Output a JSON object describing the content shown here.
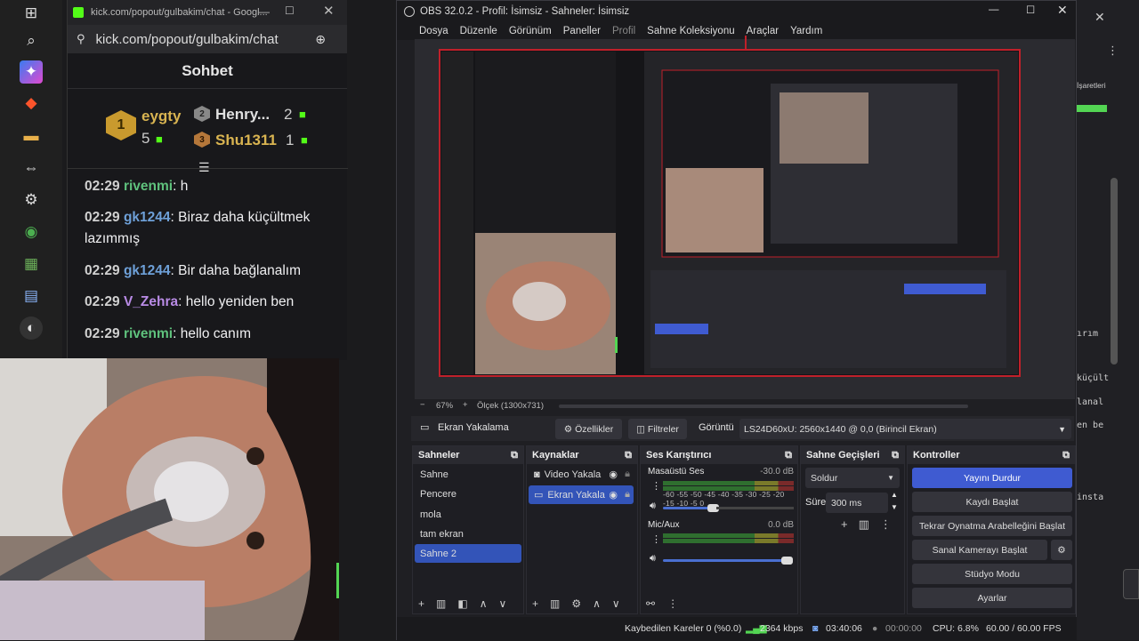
{
  "taskbar": {
    "icons": [
      "windows-icon",
      "search-icon",
      "copilot-icon",
      "brave-icon",
      "folder-icon",
      "remote-desktop-icon",
      "settings-icon",
      "chrome-icon",
      "game-icon",
      "server-icon",
      "obs-icon"
    ]
  },
  "chat": {
    "tab_title": "kick.com/popout/gulbakim/chat - Googl...",
    "url": "kick.com/popout/gulbakim/chat",
    "header": "Sohbet",
    "leaderboard": [
      {
        "rank": "1",
        "name": "eygty",
        "count": "5"
      },
      {
        "rank": "2",
        "name": "Henry...",
        "count": "2"
      },
      {
        "rank": "3",
        "name": "Shu1311",
        "count": "1"
      }
    ],
    "messages": [
      {
        "time": "02:29",
        "user": "rivenmi",
        "text": ": h",
        "color": "#5fc27d"
      },
      {
        "time": "02:29",
        "user": "gk1244",
        "text": ": Biraz daha küçültmek lazımmış",
        "color": "#6ea0d8"
      },
      {
        "time": "02:29",
        "user": "gk1244",
        "text": ": Bir daha bağlanalım",
        "color": "#6ea0d8"
      },
      {
        "time": "02:29",
        "user": "V_Zehra",
        "text": ": hello yeniden ben",
        "color": "#b98be6"
      },
      {
        "time": "02:29",
        "user": "rivenmi",
        "text": ": hello canım",
        "color": "#5fc27d"
      }
    ]
  },
  "obs": {
    "title": "OBS 32.0.2 - Profil: İsimsiz - Sahneler: İsimsiz",
    "menu": [
      "Dosya",
      "Düzenle",
      "Görünüm",
      "Paneller",
      "Profil",
      "Sahne Koleksiyonu",
      "Araçlar",
      "Yardım"
    ],
    "zoom": "67%",
    "scale": "Ölçek (1300x731)",
    "source_bar": {
      "source": "Ekran Yakalama",
      "properties": "Özellikler",
      "filters": "Filtreler",
      "display_label": "Görüntü",
      "display_value": "LS24D60xU: 2560x1440 @ 0,0 (Birincil Ekran)"
    },
    "scenes": {
      "title": "Sahneler",
      "items": [
        "Sahne",
        "Pencere",
        "mola",
        "tam ekran",
        "Sahne 2"
      ],
      "selected": "Sahne 2"
    },
    "sources": {
      "title": "Kaynaklar",
      "items": [
        "Video Yakala",
        "Ekran Yakala"
      ]
    },
    "mixer": {
      "title": "Ses Karıştırıcı",
      "channels": [
        {
          "name": "Masaüstü Ses",
          "db": "-30.0 dB",
          "level": 0.6
        },
        {
          "name": "Mic/Aux",
          "db": "0.0 dB",
          "level": 1.0
        }
      ],
      "ticks": "-60 -55 -50 -45 -40 -35 -30 -25 -20 -15 -10 -5 0"
    },
    "transitions": {
      "title": "Sahne Geçişleri",
      "type": "Soldur",
      "duration_label": "Süre",
      "duration": "300 ms"
    },
    "controls": {
      "title": "Kontroller",
      "stop_stream": "Yayını Durdur",
      "start_record": "Kaydı Başlat",
      "replay_buffer": "Tekrar Oynatma Arabelleğini Başlat",
      "virtual_cam": "Sanal Kamerayı Başlat",
      "studio_mode": "Stüdyo Modu",
      "settings": "Ayarlar"
    },
    "status": {
      "dropped": "Kaybedilen Kareler 0 (%0.0)",
      "bitrate": "2364 kbps",
      "stream_time": "03:40:06",
      "rec_time": "00:00:00",
      "cpu": "CPU: 6.8%",
      "fps": "60.00 / 60.00 FPS"
    }
  },
  "right_strip": {
    "label": "İşaretleri",
    "code_lines": [
      "ırım",
      "küçült",
      "lanal",
      "en be",
      "insta"
    ]
  },
  "colors": {
    "accent": "#3f5bd1",
    "selection": "#3354b8",
    "green_meter": "#2f8f2f"
  }
}
